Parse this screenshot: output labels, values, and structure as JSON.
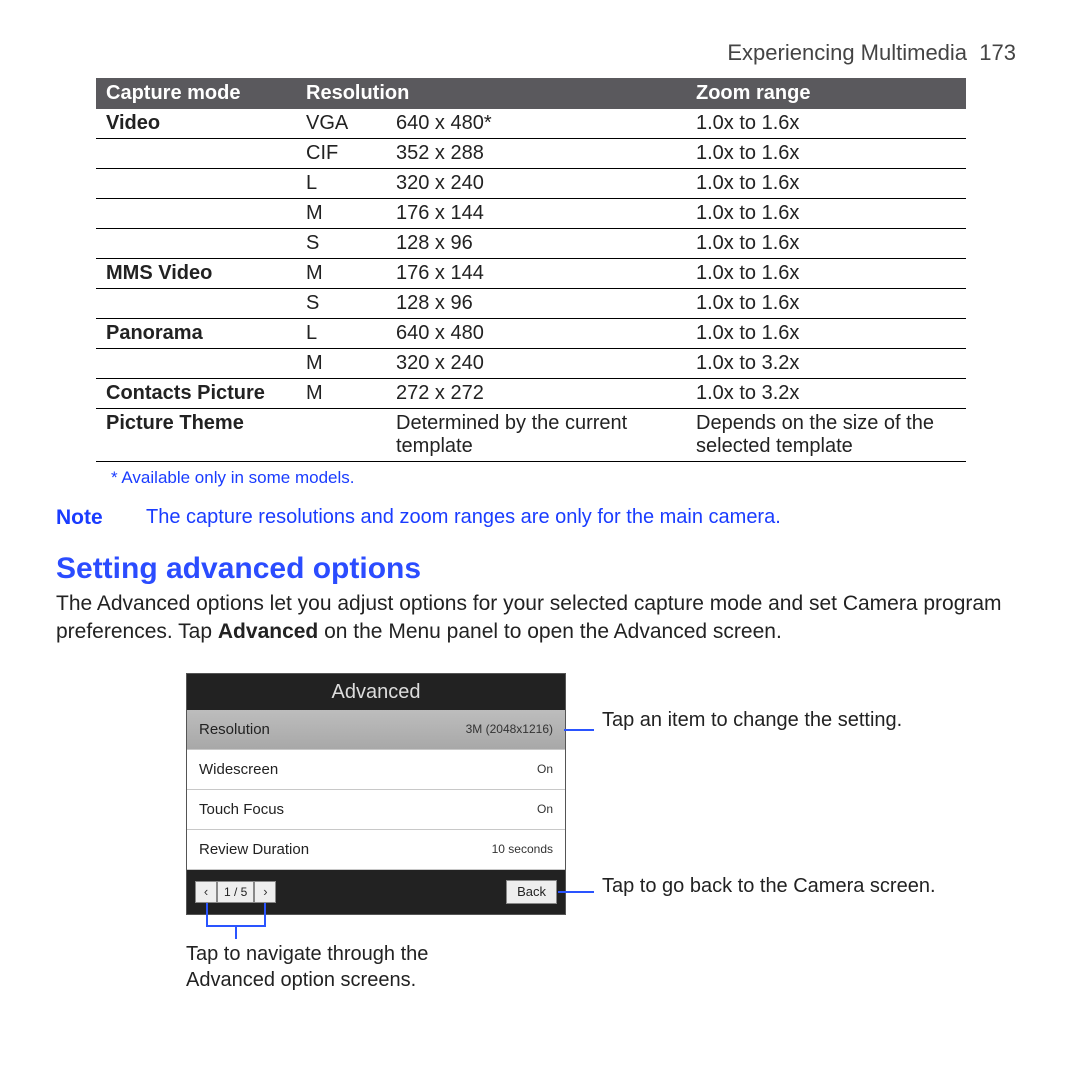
{
  "header": {
    "chapter": "Experiencing Multimedia",
    "page": "173"
  },
  "table": {
    "headers": {
      "mode": "Capture mode",
      "res": "Resolution",
      "zoom": "Zoom range"
    },
    "rows": [
      {
        "mode": "Video",
        "rescode": "VGA",
        "resval": "640 x 480*",
        "zoom": "1.0x to 1.6x"
      },
      {
        "mode": "",
        "rescode": "CIF",
        "resval": "352 x 288",
        "zoom": "1.0x to 1.6x"
      },
      {
        "mode": "",
        "rescode": "L",
        "resval": "320 x 240",
        "zoom": "1.0x to 1.6x"
      },
      {
        "mode": "",
        "rescode": "M",
        "resval": "176 x 144",
        "zoom": "1.0x to 1.6x"
      },
      {
        "mode": "",
        "rescode": "S",
        "resval": "128 x 96",
        "zoom": "1.0x to 1.6x"
      },
      {
        "mode": "MMS Video",
        "rescode": "M",
        "resval": "176 x 144",
        "zoom": "1.0x to 1.6x"
      },
      {
        "mode": "",
        "rescode": "S",
        "resval": "128 x 96",
        "zoom": "1.0x to 1.6x"
      },
      {
        "mode": "Panorama",
        "rescode": "L",
        "resval": "640 x 480",
        "zoom": "1.0x to 1.6x"
      },
      {
        "mode": "",
        "rescode": "M",
        "resval": "320 x 240",
        "zoom": "1.0x to 3.2x"
      },
      {
        "mode": "Contacts Picture",
        "rescode": "M",
        "resval": "272 x 272",
        "zoom": "1.0x to 3.2x"
      },
      {
        "mode": "Picture Theme",
        "rescode": "",
        "resval": "Determined by the current template",
        "zoom": "Depends on the size of the selected template"
      }
    ],
    "footnote": "* Available only in some models."
  },
  "note": {
    "label": "Note",
    "text": "The capture resolutions and zoom ranges are only for the main camera."
  },
  "section": {
    "title": "Setting advanced options",
    "body_pre": "The Advanced options let you adjust options for your selected capture mode and set Camera program preferences. Tap ",
    "body_bold": "Advanced",
    "body_post": " on the Menu panel to open the Advanced screen."
  },
  "phone": {
    "title": "Advanced",
    "rows": [
      {
        "label": "Resolution",
        "value": "3M (2048x1216)",
        "selected": true
      },
      {
        "label": "Widescreen",
        "value": "On",
        "selected": false
      },
      {
        "label": "Touch Focus",
        "value": "On",
        "selected": false
      },
      {
        "label": "Review Duration",
        "value": "10 seconds",
        "selected": false
      }
    ],
    "pager": {
      "prev": "‹",
      "count": "1 / 5",
      "next": "›"
    },
    "back": "Back"
  },
  "callouts": {
    "item": "Tap an item to change the setting.",
    "back": "Tap to go back to the Camera screen.",
    "nav": "Tap to navigate through the Advanced option screens."
  }
}
